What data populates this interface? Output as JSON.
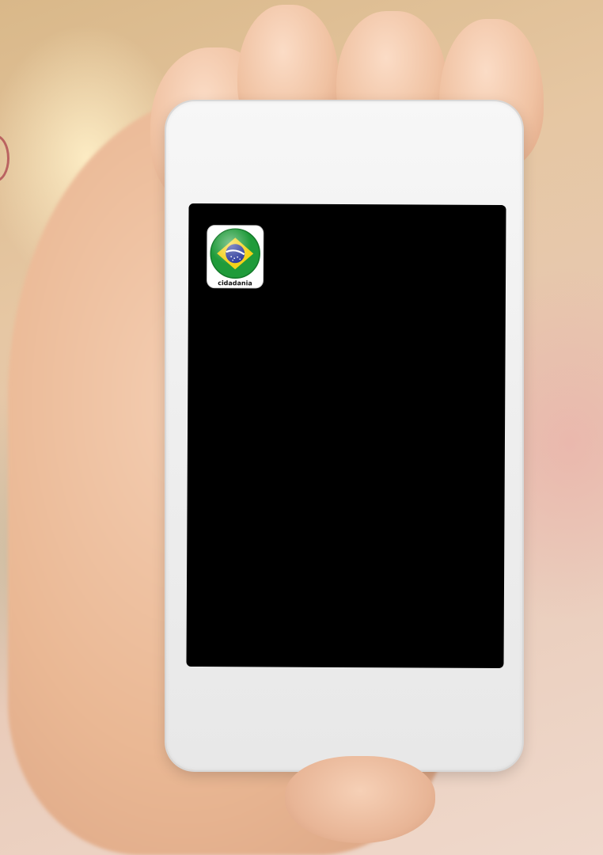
{
  "home_screen": {
    "apps": [
      {
        "label": "cidadania",
        "icon": "brazil-flag-icon",
        "colors": {
          "green": "#1f9b3a",
          "yellow": "#f3d21a",
          "blue": "#2b3a9c",
          "band": "#ffffff"
        }
      }
    ]
  },
  "colors": {
    "screen": "#000000",
    "phone_body": "#f2f2f2"
  }
}
